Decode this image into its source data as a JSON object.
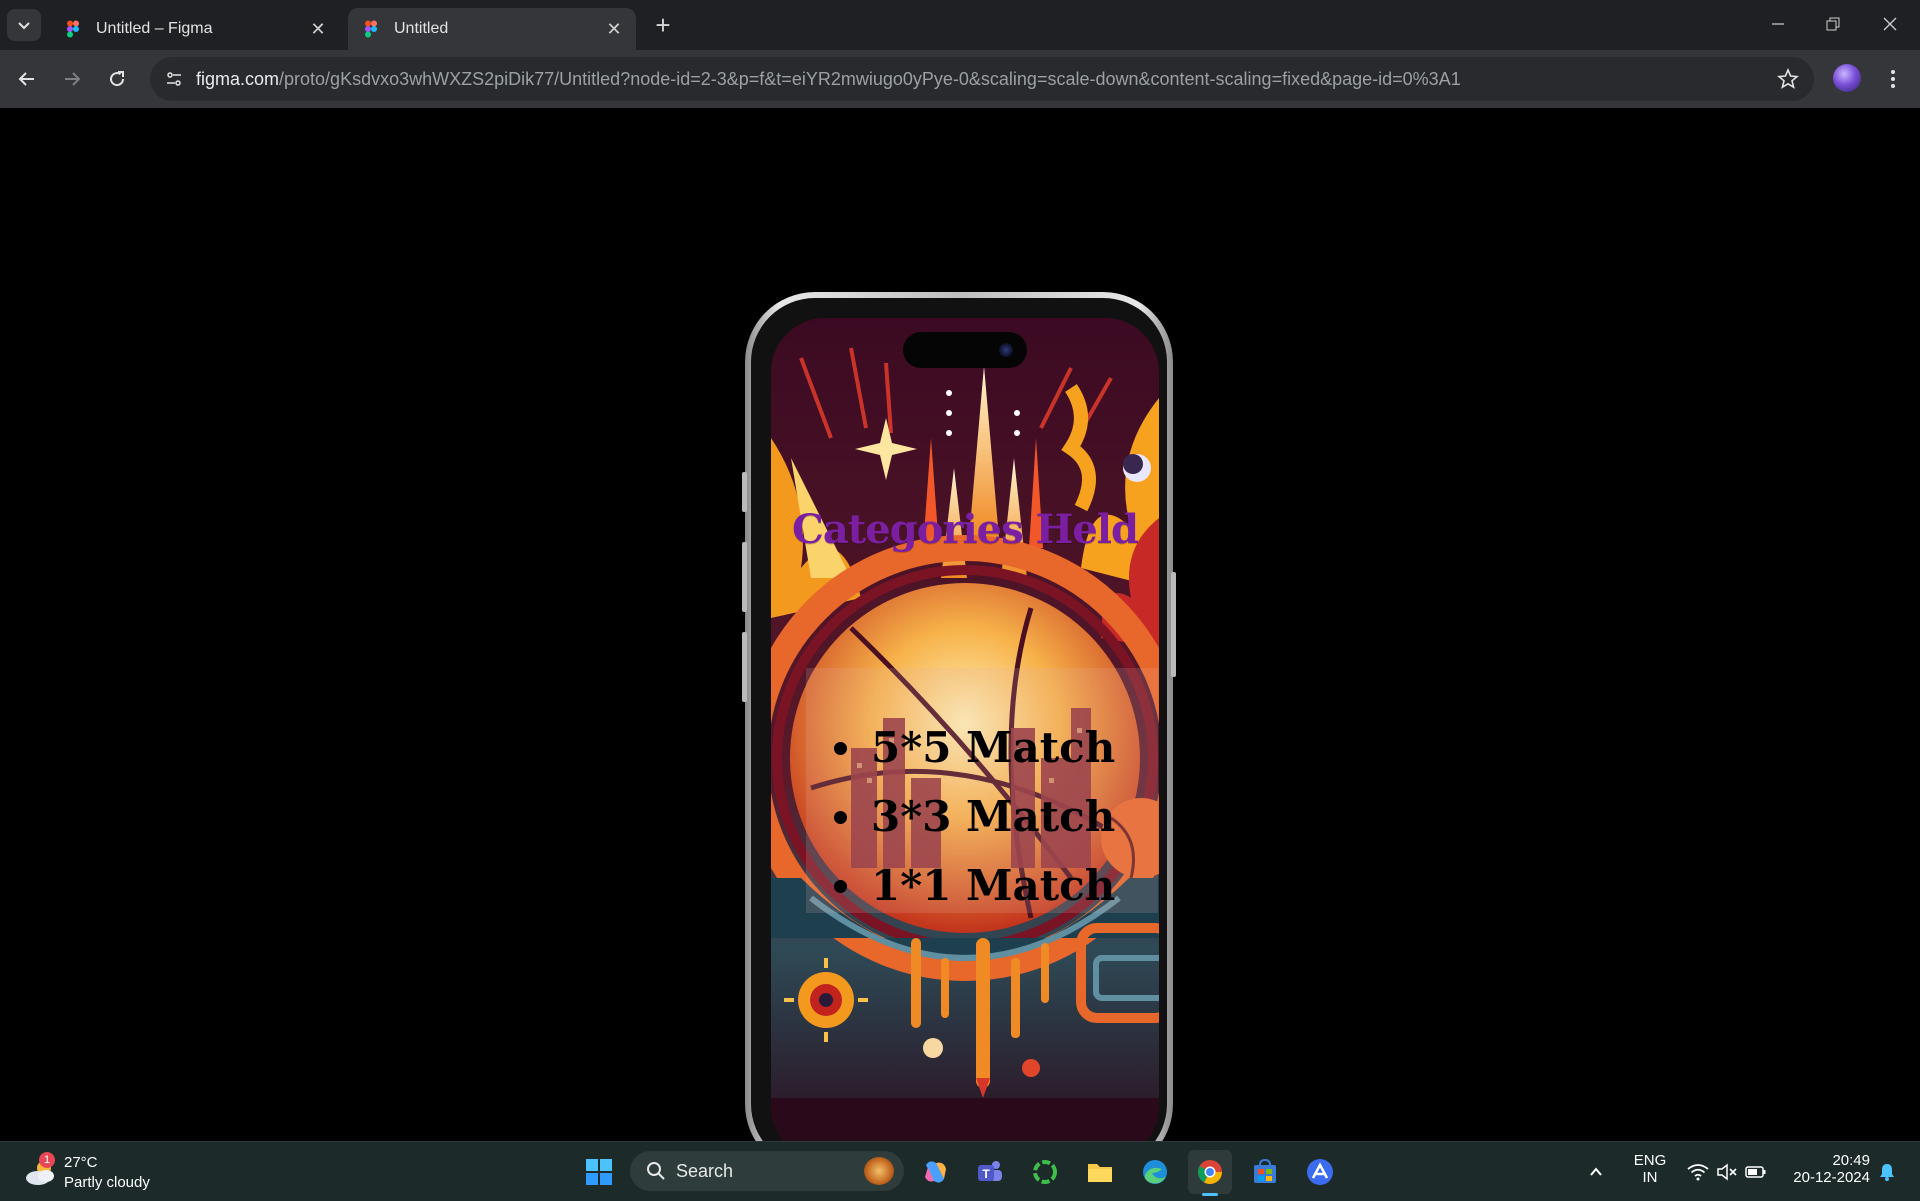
{
  "browser": {
    "tabs": [
      {
        "title": "Untitled – Figma",
        "active": false
      },
      {
        "title": "Untitled",
        "active": true
      }
    ],
    "address": {
      "host": "figma.com",
      "path": "/proto/gKsdvxo3whWXZS2piDik77/Untitled?node-id=2-3&p=f&t=eiYR2mwiugo0yPye-0&scaling=scale-down&content-scaling=fixed&page-id=0%3A1"
    }
  },
  "screen": {
    "title": "Categories Held",
    "matches": [
      "5*5 Match",
      "3*3 Match",
      "1*1 Match"
    ],
    "title_color": "#7b1fa2"
  },
  "taskbar": {
    "weather": {
      "temp": "27°C",
      "desc": "Partly cloudy",
      "badge": "1"
    },
    "search_label": "Search",
    "language": {
      "line1": "ENG",
      "line2": "IN"
    },
    "time": "20:49",
    "date": "20-12-2024"
  }
}
